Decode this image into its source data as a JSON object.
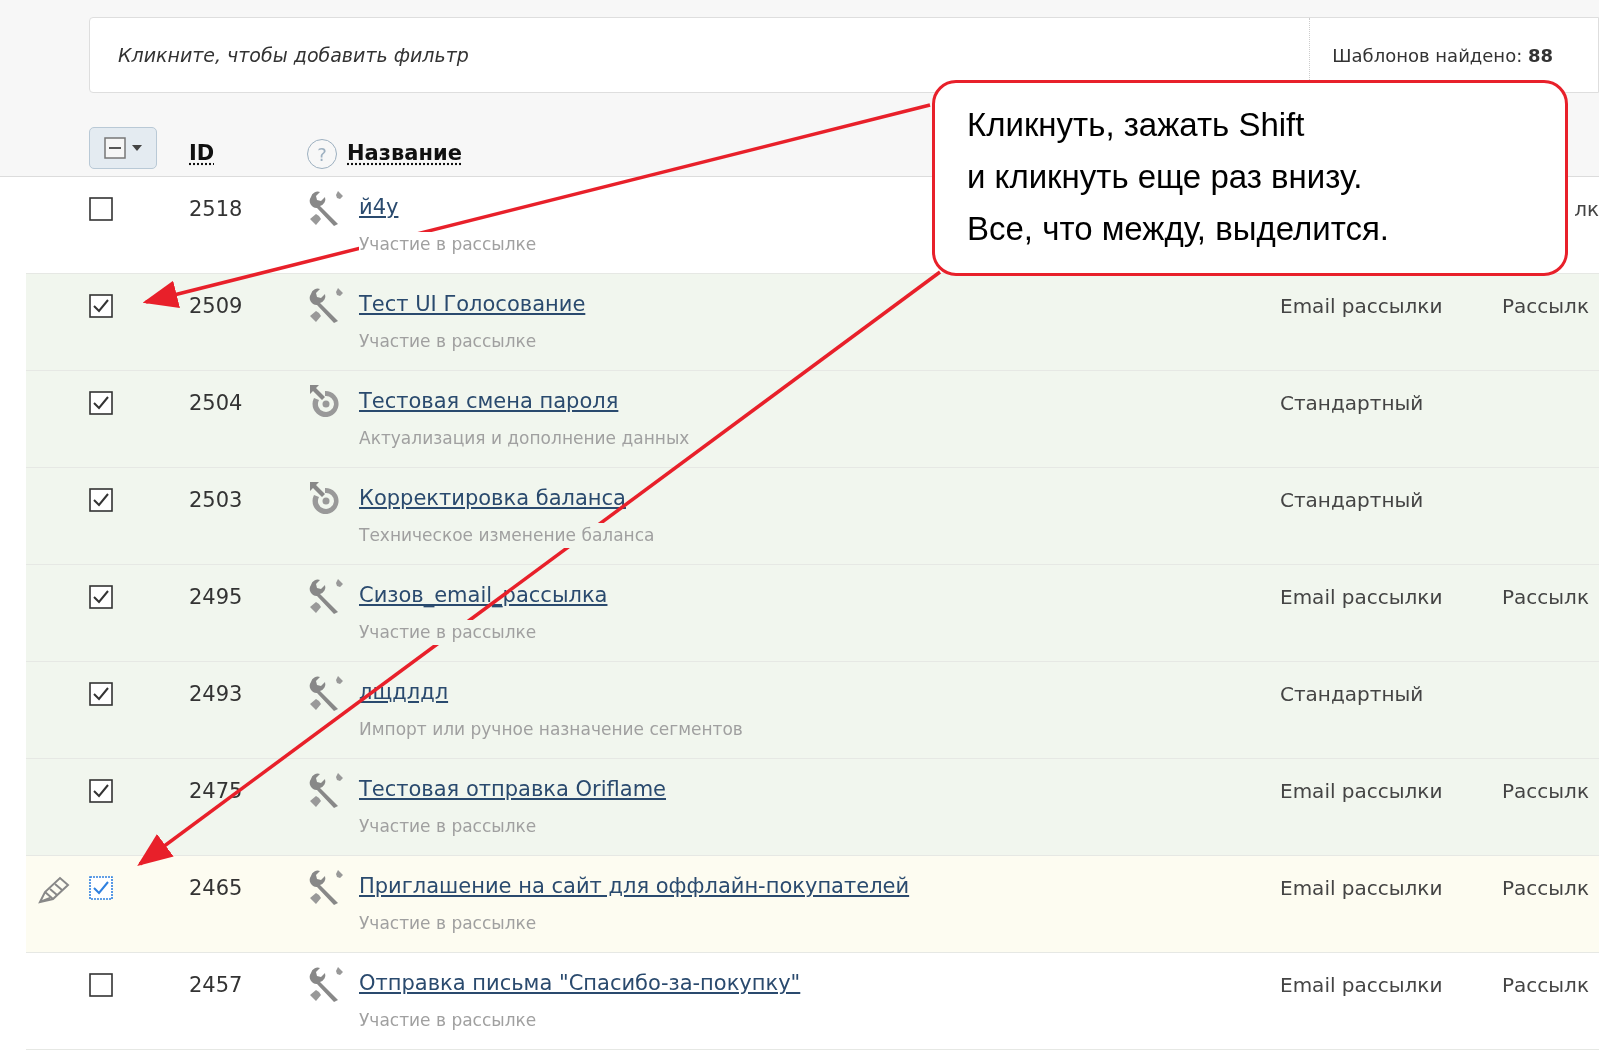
{
  "filter_bar": {
    "placeholder": "Кликните, чтобы добавить фильтр",
    "found": "Шаблонов найдено: **88**"
  },
  "header": {
    "id": "ID",
    "help": "?",
    "name": "Название"
  },
  "rows": [
    {
      "id": "2518",
      "kind": "tools",
      "name": "й4у",
      "subtitle": "Участие в рассылке",
      "checked": false,
      "focused": false,
      "column_5": "лк"
    },
    {
      "id": "2509",
      "kind": "tools",
      "name": "Тест UI Голосование",
      "subtitle": "Участие в рассылке",
      "checked": true,
      "focused": false,
      "column_4": "Email рассылки",
      "column_5": "Рассылк"
    },
    {
      "id": "2504",
      "kind": "update",
      "name": "Тестовая смена пароля",
      "subtitle": "Актуализация и дополнение данных",
      "checked": true,
      "focused": false,
      "column_4": "Стандартный"
    },
    {
      "id": "2503",
      "kind": "update",
      "name": "Корректировка баланса",
      "subtitle": "Техническое изменение баланса",
      "checked": true,
      "focused": false,
      "column_4": "Стандартный"
    },
    {
      "id": "2495",
      "kind": "tools",
      "name": "Сизов_email_рассылка",
      "subtitle": "Участие в рассылке",
      "checked": true,
      "focused": false,
      "column_4": "Email рассылки",
      "column_5": "Рассылк"
    },
    {
      "id": "2493",
      "kind": "tools",
      "name": "лщдлдл",
      "subtitle": "Импорт или ручное назначение сегментов",
      "checked": true,
      "focused": false,
      "column_4": "Стандартный"
    },
    {
      "id": "2475",
      "kind": "tools",
      "name": "Тестовая отправка Oriflame",
      "subtitle": "Участие в рассылке",
      "checked": true,
      "focused": false,
      "column_4": "Email рассылки",
      "column_5": "Рассылк"
    },
    {
      "id": "2465",
      "kind": "tools",
      "name": "Приглашение на сайт для оффлайн-покупателей",
      "subtitle": "Участие в рассылке",
      "checked": true,
      "focused": true,
      "column_4": "Email рассылки",
      "column_5": "Рассылк"
    },
    {
      "id": "2457",
      "kind": "tools",
      "name": "Отправка письма \"Спасибо-за-покупку\"",
      "subtitle": "Участие в рассылке",
      "checked": false,
      "focused": false,
      "column_4": "Email рассылки",
      "column_5": "Рассылк"
    }
  ],
  "callout": {
    "lines": [
      "Кликнуть, зажать Shift",
      "и кликнуть еще раз внизу.",
      "Все, что между, выделится."
    ]
  }
}
